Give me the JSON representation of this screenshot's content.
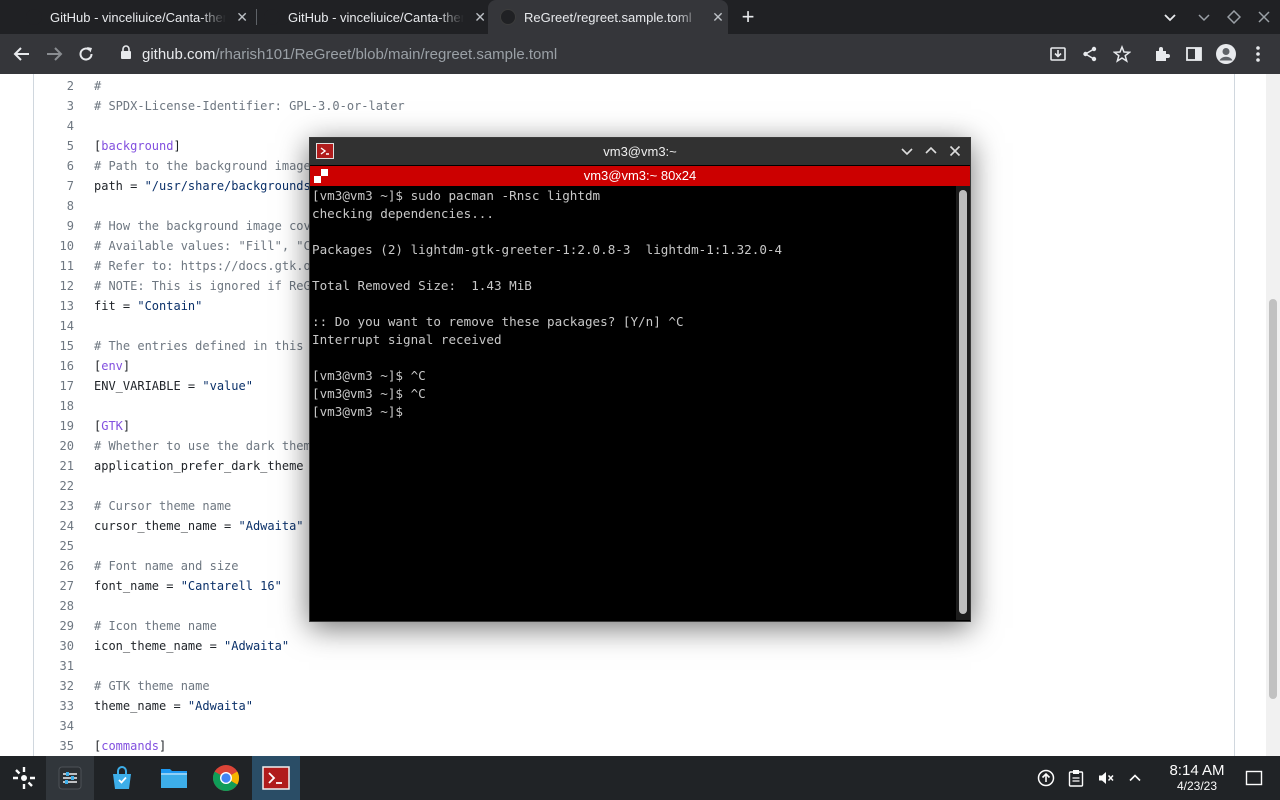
{
  "browser": {
    "tabs": [
      {
        "title": "GitHub - vinceliuice/Canta-theme",
        "active": false
      },
      {
        "title": "GitHub - vinceliuice/Canta-theme",
        "active": false
      },
      {
        "title": "ReGreet/regreet.sample.toml",
        "active": true
      }
    ],
    "new_tab_label": "+",
    "url_host": "github.com",
    "url_path": "/rharish101/ReGreet/blob/main/regreet.sample.toml"
  },
  "file": {
    "lines": [
      {
        "n": "2",
        "text": "#",
        "kind": "comment"
      },
      {
        "n": "3",
        "text": "# SPDX-License-Identifier: GPL-3.0-or-later",
        "kind": "comment"
      },
      {
        "n": "4",
        "text": "",
        "kind": "blank"
      },
      {
        "n": "5",
        "section": "background",
        "kind": "section"
      },
      {
        "n": "6",
        "text": "# Path to the background image",
        "kind": "comment"
      },
      {
        "n": "7",
        "key": "path",
        "value": "\"/usr/share/backgrounds",
        "kind": "kv"
      },
      {
        "n": "8",
        "text": "",
        "kind": "blank"
      },
      {
        "n": "9",
        "text": "# How the background image cov",
        "kind": "comment"
      },
      {
        "n": "10",
        "text": "# Available values: \"Fill\", \"C",
        "kind": "comment"
      },
      {
        "n": "11",
        "text": "# Refer to: https://docs.gtk.o",
        "kind": "comment"
      },
      {
        "n": "12",
        "text": "# NOTE: This is ignored if ReG",
        "kind": "comment"
      },
      {
        "n": "13",
        "key": "fit",
        "value": "\"Contain\"",
        "kind": "kv"
      },
      {
        "n": "14",
        "text": "",
        "kind": "blank"
      },
      {
        "n": "15",
        "text": "# The entries defined in this",
        "kind": "comment"
      },
      {
        "n": "16",
        "section": "env",
        "kind": "section"
      },
      {
        "n": "17",
        "key": "ENV_VARIABLE",
        "value": "\"value\"",
        "kind": "kv"
      },
      {
        "n": "18",
        "text": "",
        "kind": "blank"
      },
      {
        "n": "19",
        "section": "GTK",
        "kind": "section"
      },
      {
        "n": "20",
        "text": "# Whether to use the dark them",
        "kind": "comment"
      },
      {
        "n": "21",
        "text": "application_prefer_dark_theme",
        "kind": "plain"
      },
      {
        "n": "22",
        "text": "",
        "kind": "blank"
      },
      {
        "n": "23",
        "text": "# Cursor theme name",
        "kind": "comment"
      },
      {
        "n": "24",
        "key": "cursor_theme_name",
        "value": "\"Adwaita\"",
        "kind": "kv"
      },
      {
        "n": "25",
        "text": "",
        "kind": "blank"
      },
      {
        "n": "26",
        "text": "# Font name and size",
        "kind": "comment"
      },
      {
        "n": "27",
        "key": "font_name",
        "value": "\"Cantarell 16\"",
        "kind": "kv"
      },
      {
        "n": "28",
        "text": "",
        "kind": "blank"
      },
      {
        "n": "29",
        "text": "# Icon theme name",
        "kind": "comment"
      },
      {
        "n": "30",
        "key": "icon_theme_name",
        "value": "\"Adwaita\"",
        "kind": "kv"
      },
      {
        "n": "31",
        "text": "",
        "kind": "blank"
      },
      {
        "n": "32",
        "text": "# GTK theme name",
        "kind": "comment"
      },
      {
        "n": "33",
        "key": "theme_name",
        "value": "\"Adwaita\"",
        "kind": "kv"
      },
      {
        "n": "34",
        "text": "",
        "kind": "blank"
      },
      {
        "n": "35",
        "section": "commands",
        "kind": "section"
      }
    ]
  },
  "terminal": {
    "window_title": "vm3@vm3:~",
    "tab_title": "vm3@vm3:~ 80x24",
    "lines": [
      "[vm3@vm3 ~]$ sudo pacman -Rnsc lightdm",
      "checking dependencies...",
      "",
      "Packages (2) lightdm-gtk-greeter-1:2.0.8-3  lightdm-1:1.32.0-4",
      "",
      "Total Removed Size:  1.43 MiB",
      "",
      ":: Do you want to remove these packages? [Y/n] ^C",
      "Interrupt signal received",
      "",
      "[vm3@vm3 ~]$ ^C",
      "[vm3@vm3 ~]$ ^C",
      "[vm3@vm3 ~]$"
    ]
  },
  "taskbar": {
    "time": "8:14 AM",
    "date": "4/23/23",
    "apps": [
      "app-launcher-icon",
      "system-settings-icon",
      "discover-store-icon",
      "file-manager-icon",
      "chrome-icon",
      "terminal-icon"
    ]
  },
  "colors": {
    "terminal_accent": "#cc0000",
    "browser_dark": "#202124",
    "link_section": "#8250df"
  }
}
